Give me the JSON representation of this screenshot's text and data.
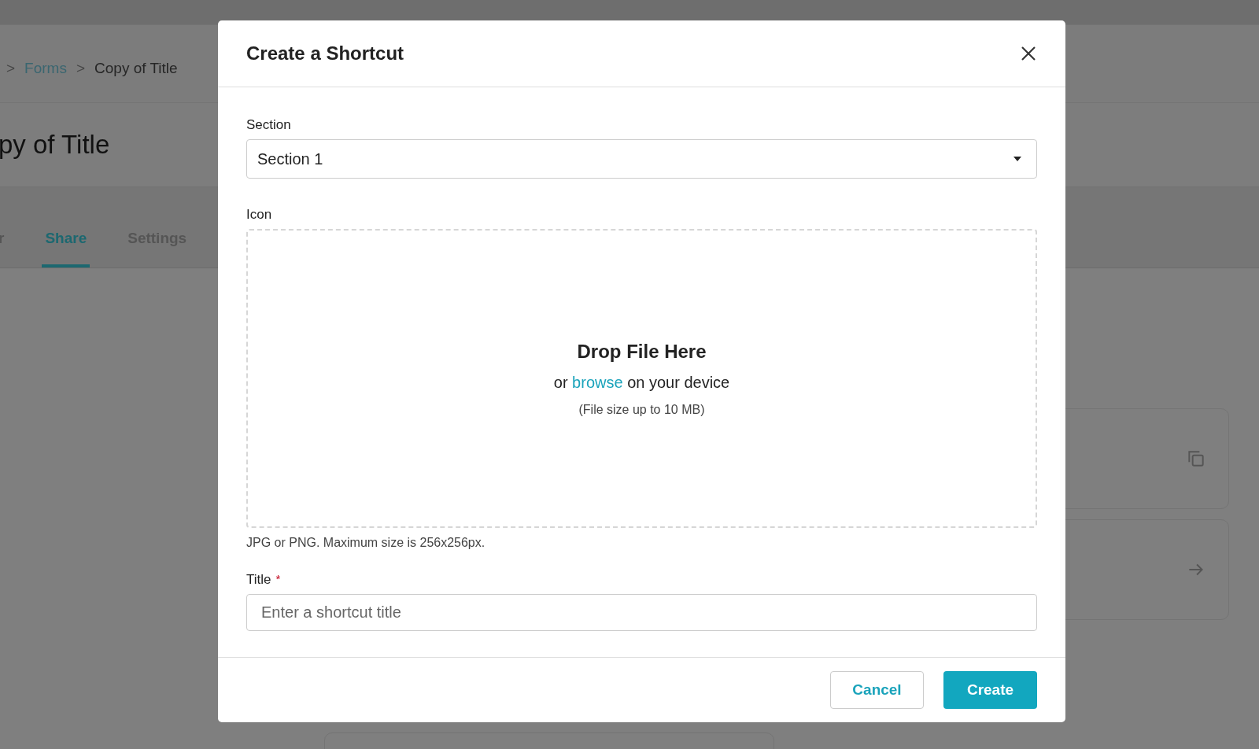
{
  "background_page": {
    "breadcrumb": [
      {
        "label": ">",
        "kind": "separator"
      },
      {
        "label": "Forms",
        "kind": "link"
      },
      {
        "label": ">",
        "kind": "separator"
      },
      {
        "label": "Copy of Title",
        "kind": "current"
      }
    ],
    "page_title": "py of Title",
    "tabs": [
      {
        "label": "r",
        "selected": false
      },
      {
        "label": "Share",
        "selected": true
      },
      {
        "label": "Settings",
        "selected": false
      }
    ]
  },
  "dialog": {
    "title": "Create a Shortcut",
    "section": {
      "label": "Section",
      "value": "Section 1"
    },
    "icon": {
      "label": "Icon",
      "drop_title": "Drop File Here",
      "browse_before": "or",
      "browse_link": "browse",
      "browse_after": "on your device",
      "size_note": "(File size up to 10 MB)",
      "hint": "JPG or PNG. Maximum size is 256x256px."
    },
    "title_field": {
      "label": "Title",
      "required_mark": "*",
      "placeholder": "Enter a shortcut title"
    },
    "buttons": [
      {
        "label": "Cancel",
        "kind": "secondary"
      },
      {
        "label": "Create",
        "kind": "primary"
      }
    ]
  }
}
